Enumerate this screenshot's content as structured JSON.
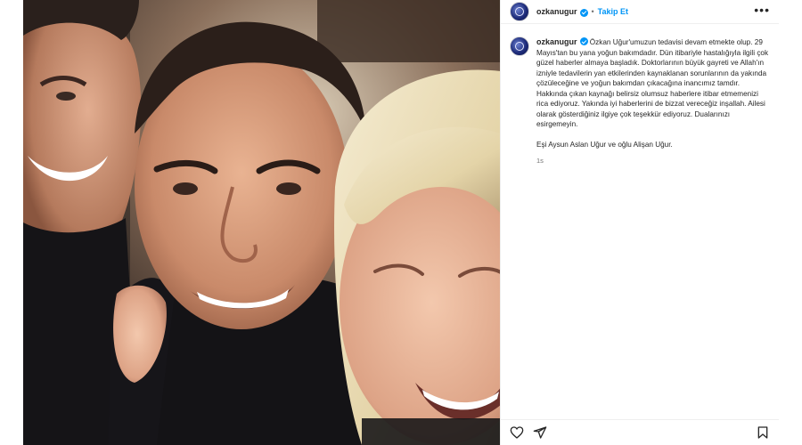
{
  "post": {
    "username": "ozkanugur",
    "follow_separator": "•",
    "follow_label": "Takip Et",
    "more_label": "•••",
    "caption_username": "ozkanugur",
    "caption": "Özkan Uğur'umuzun tedavisi devam etmekte olup. 29 Mayıs'tan bu yana yoğun bakımdadır. Dün itibariyle hastalığıyla ilgili çok güzel haberler almaya başladık. Doktorlarının büyük gayreti ve Allah'ın izniyle tedavilerin yan etkilerinden kaynaklanan sorunlarının da yakında çözüleceğine ve yoğun bakımdan çıkacağına inancımız tamdır. Hakkında çıkan kaynağı belirsiz olumsuz haberlere itibar etmemenizi rica ediyoruz. Yakında iyi haberlerini de bizzat vereceğiz inşallah. Ailesi olarak gösterdiğiniz ilgiye çok teşekkür ediyoruz. Dualarınızı esirgemeyin.\n\nEşi Aysun Aslan Uğur ve oğlu Alişan Uğur.",
    "time_ago": "1s"
  },
  "icons": {
    "like": "heart-icon",
    "share": "send-icon",
    "save": "bookmark-icon",
    "verified": "verified-badge-icon",
    "more": "more-options-icon"
  },
  "colors": {
    "link": "#0095f6",
    "text": "#262626",
    "muted": "#737373",
    "border": "#efefef"
  }
}
